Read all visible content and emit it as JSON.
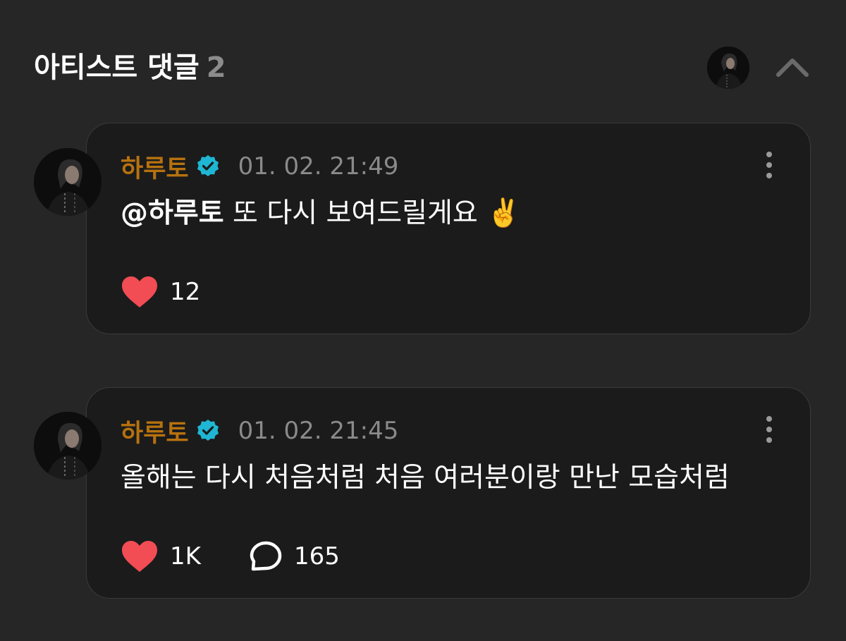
{
  "header": {
    "title": "아티스트 댓글",
    "count": "2"
  },
  "comments": [
    {
      "author": "하루토",
      "timestamp": "01. 02. 21:49",
      "mention": "@하루토",
      "text": "또 다시 보여드릴게요",
      "emoji": "✌️",
      "likes": "12"
    },
    {
      "author": "하루토",
      "timestamp": "01. 02. 21:45",
      "text": "올해는 다시 처음처럼 처음 여러분이랑 만난 모습처럼",
      "likes": "1K",
      "replies": "165"
    }
  ],
  "icons": {
    "verified": "verified-badge-icon",
    "more": "kebab-menu-icon",
    "like": "heart-icon",
    "reply": "speech-bubble-icon",
    "collapse": "chevron-up-icon"
  },
  "colors": {
    "background": "#262626",
    "card": "#1b1b1b",
    "author": "#b7720f",
    "verified": "#1fb6d4",
    "heart": "#f24c54"
  }
}
